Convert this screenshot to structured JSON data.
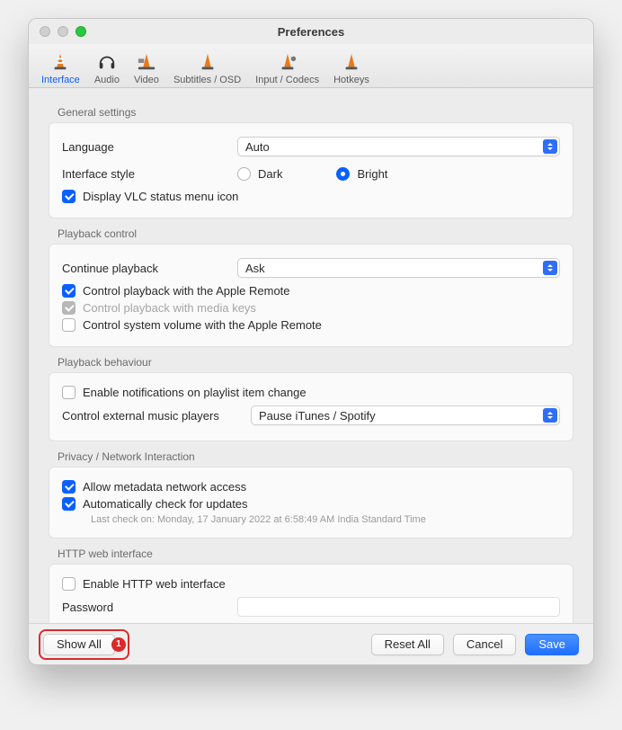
{
  "window": {
    "title": "Preferences"
  },
  "toolbar": {
    "items": [
      {
        "label": "Interface"
      },
      {
        "label": "Audio"
      },
      {
        "label": "Video"
      },
      {
        "label": "Subtitles / OSD"
      },
      {
        "label": "Input / Codecs"
      },
      {
        "label": "Hotkeys"
      }
    ],
    "selected": "Interface"
  },
  "sections": {
    "general": {
      "title": "General settings",
      "language_label": "Language",
      "language_value": "Auto",
      "style_label": "Interface style",
      "style_options": {
        "dark": "Dark",
        "bright": "Bright"
      },
      "style_selected": "Bright",
      "status_menu_label": "Display VLC status menu icon",
      "status_menu_checked": true
    },
    "playback_control": {
      "title": "Playback control",
      "continue_label": "Continue playback",
      "continue_value": "Ask",
      "apple_remote_label": "Control playback with the Apple Remote",
      "apple_remote_checked": true,
      "media_keys_label": "Control playback with media keys",
      "media_keys_checked": true,
      "media_keys_disabled": true,
      "system_volume_label": "Control system volume with the Apple Remote",
      "system_volume_checked": false
    },
    "playback_behaviour": {
      "title": "Playback behaviour",
      "notifications_label": "Enable notifications on playlist item change",
      "notifications_checked": false,
      "external_players_label": "Control external music players",
      "external_players_value": "Pause iTunes / Spotify"
    },
    "privacy": {
      "title": "Privacy / Network Interaction",
      "metadata_label": "Allow metadata network access",
      "metadata_checked": true,
      "updates_label": "Automatically check for updates",
      "updates_checked": true,
      "updates_note": "Last check on: Monday, 17 January 2022 at 6:58:49 AM India Standard Time"
    },
    "http": {
      "title": "HTTP web interface",
      "enable_label": "Enable HTTP web interface",
      "enable_checked": false,
      "password_label": "Password",
      "password_value": ""
    }
  },
  "footer": {
    "show_all": "Show All",
    "show_all_badge": "1",
    "reset_all": "Reset All",
    "cancel": "Cancel",
    "save": "Save"
  }
}
